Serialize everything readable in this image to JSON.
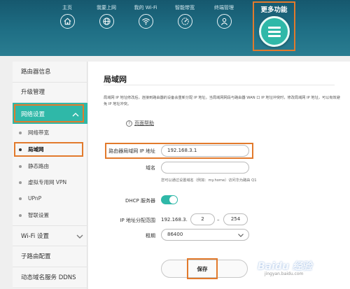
{
  "header": {
    "nav": [
      {
        "label": "主页",
        "icon": "home-icon"
      },
      {
        "label": "我要上网",
        "icon": "globe-icon"
      },
      {
        "label": "我的 Wi-Fi",
        "icon": "wifi-icon"
      },
      {
        "label": "智能带宽",
        "icon": "bandwidth-icon"
      },
      {
        "label": "终端管理",
        "icon": "user-icon"
      }
    ],
    "more": {
      "label": "更多功能",
      "icon": "menu-icon"
    }
  },
  "sidebar": {
    "router_info": "路由器信息",
    "upgrade": "升级管理",
    "network_settings": "网络设置",
    "sub_items": [
      "网络带宽",
      "局域网",
      "静态路由",
      "虚拟专用网 VPN",
      "UPnP",
      "智联设置"
    ],
    "active_sub": "局域网",
    "wifi_settings": "Wi-Fi 设置",
    "sub_router": "子路由配置",
    "ddns": "动态域名服务 DDNS"
  },
  "main": {
    "title": "局域网",
    "description": "局域网 IP 地址修改后，连接到路由器的设备会重新分配 IP 地址。当局域网网段与路由器 WAN 口 IP 地址冲突时，修改局域网 IP 地址，可以有效避免 IP 地址冲突。",
    "help": "页面帮助",
    "help_icon": "question-icon",
    "form": {
      "ip_label": "路由器局域网 IP 地址",
      "ip_value": "192.168.3.1",
      "domain_label": "域名",
      "domain_value": "",
      "hint": "您可以通过设置域名（例如：my.home）访问华为路由 Q1",
      "dhcp_label": "DHCP 服务器",
      "dhcp_enabled": true,
      "range_label": "IP 地址分配范围",
      "range_prefix": "192.168.3.",
      "range_start": "2",
      "range_end": "254",
      "lease_label": "租期",
      "lease_value": "86400"
    },
    "save_label": "保存"
  },
  "watermark": {
    "brand": "Baidu 经验",
    "url": "jingyan.baidu.com"
  },
  "colors": {
    "header": "#1f6f85",
    "accent": "#2fb8a8",
    "highlight": "#e27a2c"
  }
}
